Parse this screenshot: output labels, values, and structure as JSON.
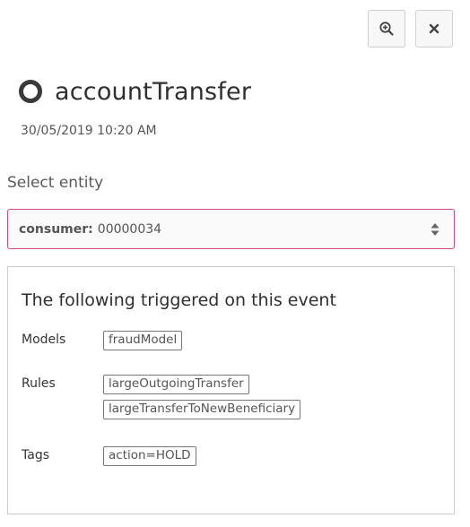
{
  "header": {
    "zoom_icon": "zoom-in-icon",
    "close_icon": "close-icon",
    "status_icon": "hollow-circle-icon",
    "title": "accountTransfer",
    "timestamp": "30/05/2019 10:20 AM"
  },
  "entity_selector": {
    "label": "Select entity",
    "key": "consumer:",
    "value": "00000034",
    "accent_color": "#d24a83"
  },
  "triggers": {
    "heading": "The following triggered on this event",
    "models_label": "Models",
    "models": [
      "fraudModel"
    ],
    "rules_label": "Rules",
    "rules": [
      "largeOutgoingTransfer",
      "largeTransferToNewBeneficiary"
    ],
    "tags_label": "Tags",
    "tags": [
      "action=HOLD"
    ]
  }
}
